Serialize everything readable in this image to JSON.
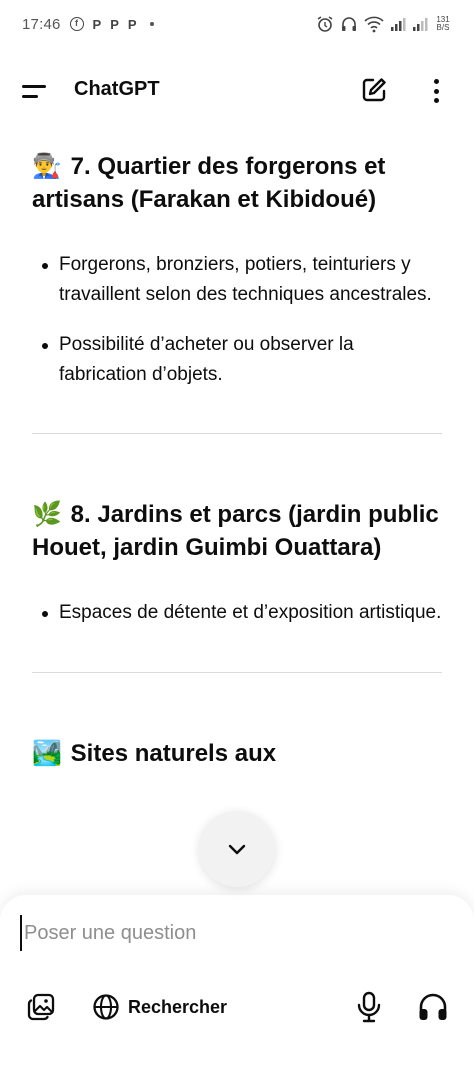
{
  "status_bar": {
    "time": "17:46",
    "notification_icons": [
      "facebook-icon",
      "p-app-icon",
      "p-app-icon",
      "p-app-icon"
    ],
    "p_letter": "P",
    "fb_letter": "f",
    "net_speed_value": "131",
    "net_speed_unit": "B/S"
  },
  "app_bar": {
    "title": "ChatGPT"
  },
  "sections": [
    {
      "emoji": "👨‍🏭",
      "title": "7. Quartier des forgerons et artisans (Farakan et Kibidoué)",
      "bullets": [
        "Forgerons, bronziers, potiers, teinturiers y travaillent selon des techniques ancestrales.",
        "Possibilité d’acheter ou observer la fabrication d’objets."
      ]
    },
    {
      "emoji": "🌿",
      "title": "8. Jardins et parcs (jardin public Houet, jardin Guimbi Ouattara)",
      "bullets": [
        "Espaces de détente et d’exposition artistique."
      ]
    },
    {
      "emoji": "🏞️",
      "title": "Sites naturels aux"
    }
  ],
  "composer": {
    "placeholder": "Poser une question",
    "value": "",
    "search_label": "Rechercher"
  }
}
